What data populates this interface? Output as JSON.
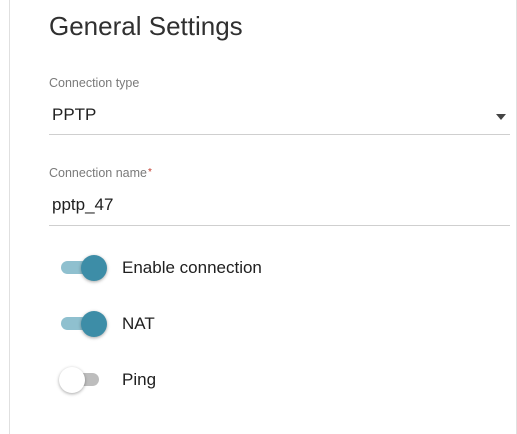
{
  "section": {
    "title": "General Settings"
  },
  "connection_type": {
    "label": "Connection type",
    "value": "PPTP"
  },
  "connection_name": {
    "label": "Connection name",
    "required_mark": "*",
    "value": "pptp_47"
  },
  "toggles": [
    {
      "label": "Enable connection",
      "enabled": true
    },
    {
      "label": "NAT",
      "enabled": true
    },
    {
      "label": "Ping",
      "enabled": false
    }
  ],
  "colors": {
    "accent": "#3d8da7",
    "track_on": "#8fc0cf",
    "track_off": "#bdbdbd",
    "required": "#c0392b"
  },
  "icons": {
    "dropdown": "chevron-down-icon"
  }
}
